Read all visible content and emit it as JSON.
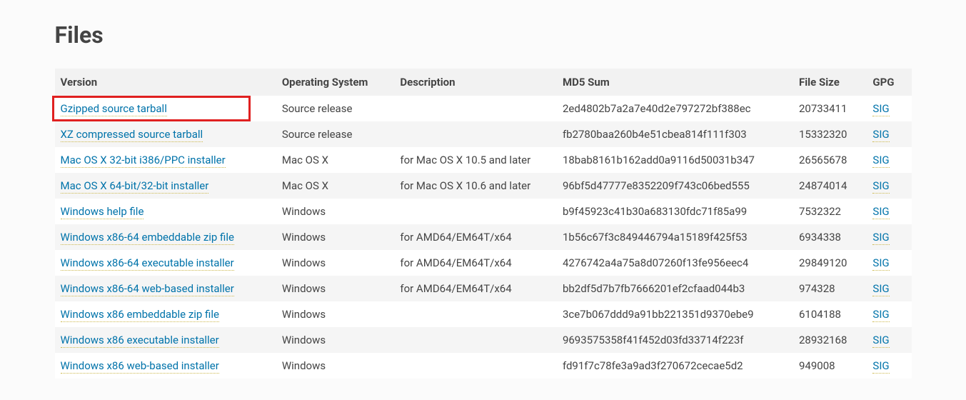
{
  "heading": "Files",
  "columns": {
    "version": "Version",
    "os": "Operating System",
    "desc": "Description",
    "md5": "MD5 Sum",
    "size": "File Size",
    "gpg": "GPG"
  },
  "sig_label": "SIG",
  "rows": [
    {
      "version": "Gzipped source tarball",
      "os": "Source release",
      "desc": "",
      "md5": "2ed4802b7a2a7e40d2e797272bf388ec",
      "size": "20733411"
    },
    {
      "version": "XZ compressed source tarball",
      "os": "Source release",
      "desc": "",
      "md5": "fb2780baa260b4e51cbea814f111f303",
      "size": "15332320"
    },
    {
      "version": "Mac OS X 32-bit i386/PPC installer",
      "os": "Mac OS X",
      "desc": "for Mac OS X 10.5 and later",
      "md5": "18bab8161b162add0a9116d50031b347",
      "size": "26565678"
    },
    {
      "version": "Mac OS X 64-bit/32-bit installer",
      "os": "Mac OS X",
      "desc": "for Mac OS X 10.6 and later",
      "md5": "96bf5d47777e8352209f743c06bed555",
      "size": "24874014"
    },
    {
      "version": "Windows help file",
      "os": "Windows",
      "desc": "",
      "md5": "b9f45923c41b30a683130fdc71f85a99",
      "size": "7532322"
    },
    {
      "version": "Windows x86-64 embeddable zip file",
      "os": "Windows",
      "desc": "for AMD64/EM64T/x64",
      "md5": "1b56c67f3c849446794a15189f425f53",
      "size": "6934338"
    },
    {
      "version": "Windows x86-64 executable installer",
      "os": "Windows",
      "desc": "for AMD64/EM64T/x64",
      "md5": "4276742a4a75a8d07260f13fe956eec4",
      "size": "29849120"
    },
    {
      "version": "Windows x86-64 web-based installer",
      "os": "Windows",
      "desc": "for AMD64/EM64T/x64",
      "md5": "bb2df5d7b7fb7666201ef2cfaad044b3",
      "size": "974328"
    },
    {
      "version": "Windows x86 embeddable zip file",
      "os": "Windows",
      "desc": "",
      "md5": "3ce7b067ddd9a91bb221351d9370ebe9",
      "size": "6104188"
    },
    {
      "version": "Windows x86 executable installer",
      "os": "Windows",
      "desc": "",
      "md5": "9693575358f41f452d03fd33714f223f",
      "size": "28932168"
    },
    {
      "version": "Windows x86 web-based installer",
      "os": "Windows",
      "desc": "",
      "md5": "fd91f7c78fe3a9ad3f270672cecae5d2",
      "size": "949008"
    }
  ]
}
